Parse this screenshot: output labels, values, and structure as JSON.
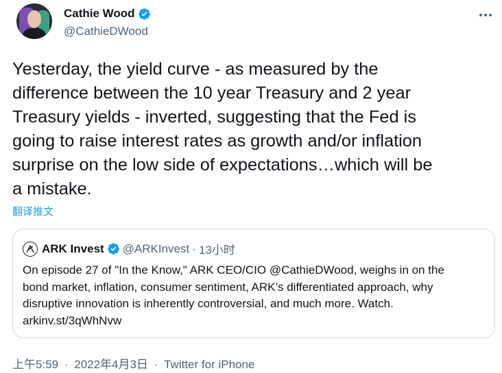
{
  "author": {
    "name": "Cathie Wood",
    "handle": "@CathieDWood"
  },
  "tweet": {
    "text": "Yesterday, the yield curve - as measured by the\ndifference between the 10 year Treasury and 2 year\nTreasury yields - inverted, suggesting that the Fed is\ngoing to raise interest rates as growth and/or inflation\nsurprise on the low side of expectations…which will be\na mistake.",
    "translate_label": "翻译推文"
  },
  "quoted": {
    "name": "ARK Invest",
    "handle": "@ARKInvest",
    "separator": "·",
    "time": "13小时",
    "text": "On episode 27 of \"In the Know,\" ARK CEO/CIO @CathieDWood, weighs in on the\nbond market, inflation, consumer sentiment, ARK’s differentiated approach, why\ndisruptive innovation is inherently controversial, and much more. Watch.\narkinv.st/3qWhNvw"
  },
  "meta": {
    "time": "上午5:59",
    "date": "2022年4月3日",
    "source": "Twitter for iPhone",
    "separator": "·"
  },
  "colors": {
    "accent": "#1d9bf0",
    "secondary_text": "#536471",
    "border": "#cfd9de"
  },
  "icons": [
    "avatar",
    "verified-badge-icon",
    "more-options-icon",
    "ark-logo-icon"
  ]
}
